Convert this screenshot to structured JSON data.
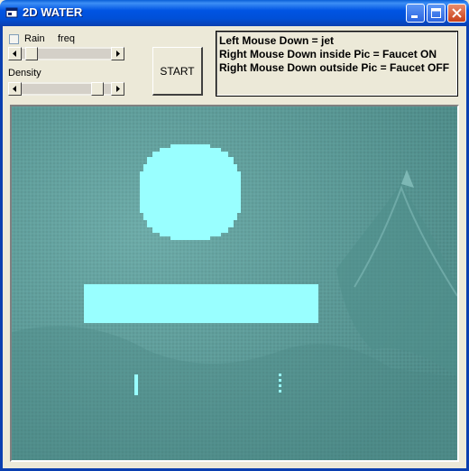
{
  "window": {
    "title": "2D WATER",
    "buttons": [
      "minimize",
      "maximize",
      "close"
    ]
  },
  "controls": {
    "rain": {
      "label": "Rain",
      "checked": false
    },
    "freq": {
      "label": "freq",
      "value_fraction": 0.05
    },
    "density": {
      "label": "Density",
      "value_fraction": 0.9
    },
    "start_label": "START"
  },
  "info": {
    "line1": "Left Mouse Down = jet",
    "line2": "Right Mouse Down inside Pic = Faucet ON",
    "line3": "Right Mouse Down outside Pic = Faucet OFF"
  },
  "colors": {
    "water": "#5f9f9c",
    "obstacle": "#99ffff",
    "titlebar": "#0054e3",
    "face": "#ece9d8"
  }
}
